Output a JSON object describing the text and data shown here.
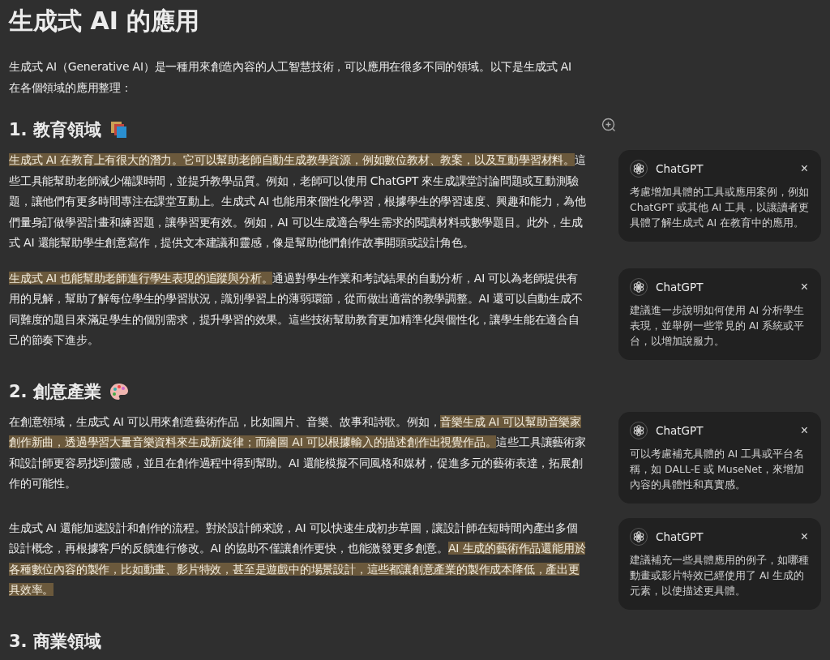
{
  "title": "生成式 AI 的應用",
  "intro": "生成式 AI（Generative AI）是一種用來創造內容的人工智慧技術，可以應用在很多不同的領域。以下是生成式 AI 在各個領域的應用整理：",
  "sections": [
    {
      "heading": "1. 教育領域",
      "paragraphs": [
        {
          "segments": [
            {
              "text": "生成式 AI 在教育上有很大的潛力。它可以幫助老師自動生成教學資源，例如數位教材、教案，以及互動學習材料。",
              "highlighted": true
            },
            {
              "text": "這些工具能幫助老師減少備課時間，並提升教學品質。例如，老師可以使用 ChatGPT 來生成課堂討論問題或互動測驗題，讓他們有更多時間專注在課堂互動上。生成式 AI 也能用來個性化學習，根據學生的學習速度、興趣和能力，為他們量身訂做學習計畫和練習題，讓學習更有效。例如，AI 可以生成適合學生需求的閱讀材料或數學題目。此外，生成式 AI 還能幫助學生創意寫作，提供文本建議和靈感，像是幫助他們創作故事開頭或設計角色。",
              "highlighted": false
            }
          ],
          "comment": {
            "author": "ChatGPT",
            "close": "×",
            "text": "考慮增加具體的工具或應用案例，例如 ChatGPT 或其他 AI 工具，以讓讀者更具體了解生成式 AI 在教育中的應用。"
          }
        },
        {
          "segments": [
            {
              "text": "生成式 AI 也能幫助老師進行學生表現的追蹤與分析。",
              "highlighted": true
            },
            {
              "text": "通過對學生作業和考試結果的自動分析，AI 可以為老師提供有用的見解，幫助了解每位學生的學習狀況，識別學習上的薄弱環節，從而做出適當的教學調整。AI 還可以自動生成不同難度的題目來滿足學生的個別需求，提升學習的效果。這些技術幫助教育更加精準化與個性化，讓學生能在適合自己的節奏下進步。",
              "highlighted": false
            }
          ],
          "comment": {
            "author": "ChatGPT",
            "close": "×",
            "text": "建議進一步說明如何使用 AI 分析學生表現，並舉例一些常見的 AI 系統或平台，以增加說服力。"
          }
        }
      ]
    },
    {
      "heading": "2. 創意產業",
      "paragraphs": [
        {
          "segments": [
            {
              "text": "在創意領域，生成式 AI 可以用來創造藝術作品，比如圖片、音樂、故事和詩歌。例如，",
              "highlighted": false
            },
            {
              "text": "音樂生成 AI 可以幫助音樂家創作新曲，透過學習大量音樂資料來生成新旋律；而繪圖 AI 可以根據輸入的描述創作出視覺作品。",
              "highlighted": true
            },
            {
              "text": "這些工具讓藝術家和設計師更容易找到靈感，並且在創作過程中得到幫助。AI 還能模擬不同風格和媒材，促進多元的藝術表達，拓展創作的可能性。",
              "highlighted": false
            }
          ],
          "comment": {
            "author": "ChatGPT",
            "close": "×",
            "text": "可以考慮補充具體的 AI 工具或平台名稱，如 DALL-E 或 MuseNet，來增加內容的具體性和真實感。"
          }
        },
        {
          "segments": [
            {
              "text": "生成式 AI 還能加速設計和創作的流程。對於設計師來說，AI 可以快速生成初步草圖，讓設計師在短時間內產出多個設計概念，再根據客戶的反饋進行修改。AI 的協助不僅讓創作更快，也能激發更多創意。",
              "highlighted": false
            },
            {
              "text": "AI 生成的藝術作品還能用於各種數位內容的製作，比如動畫、影片特效，甚至是遊戲中的場景設計，這些都讓創意產業的製作成本降低，產出更具效率。",
              "highlighted": true
            }
          ],
          "comment": {
            "author": "ChatGPT",
            "close": "×",
            "text": "建議補充一些具體應用的例子，如哪種動畫或影片特效已經使用了 AI 生成的元素，以使描述更具體。"
          }
        }
      ]
    },
    {
      "heading": "3. 商業領域"
    }
  ]
}
